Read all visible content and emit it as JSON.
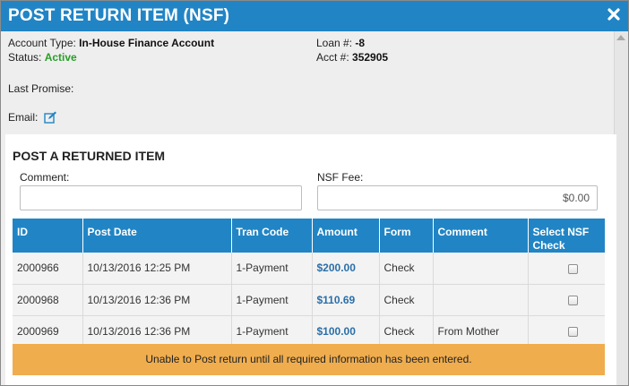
{
  "window": {
    "title": "POST RETURN ITEM (NSF)"
  },
  "account": {
    "type_label": "Account Type:",
    "type_value": "In-House Finance Account",
    "status_label": "Status:",
    "status_value": "Active",
    "loan_label": "Loan #:",
    "loan_value": "-8",
    "acct_label": "Acct #:",
    "acct_value": "352905",
    "last_promise_label": "Last Promise:",
    "email_label": "Email:"
  },
  "form": {
    "section_title": "POST A RETURNED ITEM",
    "comment_label": "Comment:",
    "comment_value": "",
    "nsf_fee_label": "NSF Fee:",
    "nsf_fee_value": "$0.00"
  },
  "table": {
    "headers": {
      "id": "ID",
      "post_date": "Post Date",
      "tran_code": "Tran Code",
      "amount": "Amount",
      "form": "Form",
      "comment": "Comment",
      "select_nsf": "Select NSF Check"
    },
    "rows": [
      {
        "id": "2000966",
        "post_date": "10/13/2016 12:25 PM",
        "tran_code": "1-Payment",
        "amount": "$200.00",
        "form": "Check",
        "comment": "",
        "checked": false
      },
      {
        "id": "2000968",
        "post_date": "10/13/2016 12:36 PM",
        "tran_code": "1-Payment",
        "amount": "$110.69",
        "form": "Check",
        "comment": "",
        "checked": false
      },
      {
        "id": "2000969",
        "post_date": "10/13/2016 12:36 PM",
        "tran_code": "1-Payment",
        "amount": "$100.00",
        "form": "Check",
        "comment": "From Mother",
        "checked": false
      }
    ]
  },
  "warning": {
    "text": "Unable to Post return until all required information has been entered."
  },
  "colors": {
    "header_blue": "#2185c5",
    "status_green": "#2a9d2a",
    "amount_blue": "#2a6fa8",
    "warning_orange": "#f0ad4e"
  },
  "icons": {
    "close": "close-icon",
    "email_edit": "edit-icon"
  }
}
